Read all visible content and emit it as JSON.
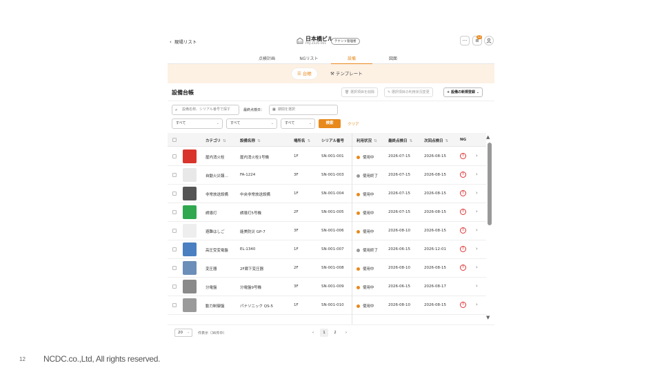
{
  "header": {
    "back_label": "現場リスト",
    "title": "日本橋ビル",
    "subtitle": "PRJ-2026-001",
    "role_badge": "テナント管理者",
    "more_icon": "more-horizontal-icon",
    "notification_icon": "task-list-icon",
    "notification_count": "12",
    "user_icon": "user-icon"
  },
  "tabs": [
    {
      "label": "点検計画"
    },
    {
      "label": "NGリスト"
    },
    {
      "label": "設備",
      "active": true
    },
    {
      "label": "図面"
    }
  ],
  "segment": {
    "ledger_label": "台帳",
    "template_label": "テンプレート"
  },
  "section": {
    "title": "設備台帳",
    "delete_selected": "選択項目を削除",
    "change_status": "選択項目の利用状況変更",
    "new_equipment": "設備の新規登録"
  },
  "filters": {
    "search_placeholder": "設備名称、シリアル番号で探す",
    "last_inspection_label": "最終点検日：",
    "date_placeholder": "期間を選択",
    "select1": "すべて",
    "select2": "すべて",
    "select3": "すべて",
    "search_button": "検索",
    "clear_button": "クリア"
  },
  "table": {
    "headers": {
      "category": "カテゴリ",
      "name": "設備名称",
      "location": "場所名",
      "serial": "シリアル番号",
      "status": "利用状況",
      "last_date": "最終点検日",
      "next_date": "次回点検日",
      "ng": "NG"
    },
    "rows": [
      {
        "category": "屋内消火栓",
        "name": "屋内消火栓1号機",
        "location": "1F",
        "serial": "SN-001-001",
        "status": "使用中",
        "status_color": "#e8891c",
        "last_date": "2026-07-15",
        "next_date": "2026-08-15",
        "ng": true,
        "thumb_color": "#d9342b"
      },
      {
        "category": "自動火災報…",
        "name": "FA-1224",
        "location": "3F",
        "serial": "SN-001-003",
        "status": "使用終了",
        "status_color": "#999999",
        "last_date": "2026-07-15",
        "next_date": "2026-08-15",
        "ng": true,
        "thumb_color": "#e8e8e8"
      },
      {
        "category": "非常放送設備",
        "name": "中央非常放送設備",
        "location": "1F",
        "serial": "SN-001-004",
        "status": "使用中",
        "status_color": "#e8891c",
        "last_date": "2026-07-15",
        "next_date": "2026-08-15",
        "ng": true,
        "thumb_color": "#555555"
      },
      {
        "category": "誘導灯",
        "name": "誘導灯5号機",
        "location": "2F",
        "serial": "SN-001-005",
        "status": "使用中",
        "status_color": "#e8891c",
        "last_date": "2026-07-15",
        "next_date": "2026-08-15",
        "ng": true,
        "thumb_color": "#2fa84f"
      },
      {
        "category": "避難はしご",
        "name": "能美防災 GP-7",
        "location": "3F",
        "serial": "SN-001-006",
        "status": "使用中",
        "status_color": "#e8891c",
        "last_date": "2026-08-10",
        "next_date": "2026-08-15",
        "ng": true,
        "thumb_color": "#eeeeee"
      },
      {
        "category": "高圧受変電盤",
        "name": "EL-1340",
        "location": "1F",
        "serial": "SN-001-007",
        "status": "使用終了",
        "status_color": "#999999",
        "last_date": "2026-06-15",
        "next_date": "2026-12-01",
        "ng": true,
        "thumb_color": "#4a7fc1"
      },
      {
        "category": "変圧器",
        "name": "2F廊下変圧器",
        "location": "2F",
        "serial": "SN-001-008",
        "status": "使用中",
        "status_color": "#e8891c",
        "last_date": "2026-08-10",
        "next_date": "2026-08-15",
        "ng": true,
        "thumb_color": "#6b8fb8"
      },
      {
        "category": "分電盤",
        "name": "分電盤9号機",
        "location": "3F",
        "serial": "SN-001-009",
        "status": "使用中",
        "status_color": "#e8891c",
        "last_date": "2026-06-15",
        "next_date": "2026-08-17",
        "ng": false,
        "thumb_color": "#8a8a8a"
      },
      {
        "category": "動力制御盤",
        "name": "パナソニック QS-5",
        "location": "1F",
        "serial": "SN-001-010",
        "status": "使用中",
        "status_color": "#e8891c",
        "last_date": "2026-08-10",
        "next_date": "2026-08-15",
        "ng": true,
        "thumb_color": "#9a9a9a"
      }
    ]
  },
  "footer": {
    "per_page": "20",
    "count_text": "件表示（36件中）",
    "pages": [
      "1",
      "2"
    ],
    "current_page": "1"
  },
  "slide": {
    "page_number": "12",
    "copyright": "NCDC.co.,Ltd, All rights reserved."
  },
  "colors": {
    "accent": "#e8891c",
    "band": "#fdf1e4",
    "ng": "#d33333"
  }
}
